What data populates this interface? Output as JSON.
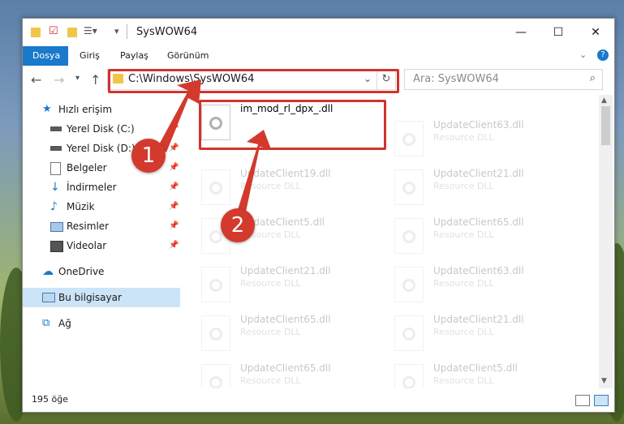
{
  "window": {
    "title": "SysWOW64",
    "controls": {
      "minimize": "—",
      "maximize": "☐",
      "close": "✕"
    }
  },
  "ribbon": {
    "tabs": [
      "Dosya",
      "Giriş",
      "Paylaş",
      "Görünüm"
    ]
  },
  "navigation": {
    "address": "C:\\Windows\\SysWOW64",
    "search_placeholder": "Ara: SysWOW64"
  },
  "sidebar": {
    "items": [
      {
        "label": "Hızlı erişim",
        "icon": "star-icon",
        "pinned": false
      },
      {
        "label": "Yerel Disk (C:)",
        "icon": "drive-icon",
        "pinned": true
      },
      {
        "label": "Yerel Disk (D:)",
        "icon": "drive-icon",
        "pinned": true
      },
      {
        "label": "Belgeler",
        "icon": "documents-icon",
        "pinned": true
      },
      {
        "label": "İndirmeler",
        "icon": "download-icon",
        "pinned": true
      },
      {
        "label": "Müzik",
        "icon": "music-icon",
        "pinned": true
      },
      {
        "label": "Resimler",
        "icon": "pictures-icon",
        "pinned": true
      },
      {
        "label": "Videolar",
        "icon": "videos-icon",
        "pinned": true
      },
      {
        "label": "OneDrive",
        "icon": "cloud-icon",
        "pinned": false
      },
      {
        "label": "Bu bilgisayar",
        "icon": "computer-icon",
        "pinned": false
      },
      {
        "label": "Ağ",
        "icon": "network-icon",
        "pinned": false
      }
    ]
  },
  "files": {
    "col1": [
      {
        "name": "im_mod_rl_dpx_.dll",
        "type": ""
      },
      {
        "name": "UpdateClient19.dll",
        "type": "Resource DLL"
      },
      {
        "name": "UpdateClient5.dll",
        "type": "Resource DLL"
      },
      {
        "name": "UpdateClient21.dll",
        "type": "Resource DLL"
      },
      {
        "name": "UpdateClient65.dll",
        "type": "Resource DLL"
      },
      {
        "name": "UpdateClient65.dll",
        "type": "Resource DLL"
      }
    ],
    "col2": [
      {
        "name": "UpdateClient63.dll",
        "type": "Resource DLL"
      },
      {
        "name": "UpdateClient21.dll",
        "type": "Resource DLL"
      },
      {
        "name": "UpdateClient65.dll",
        "type": "Resource DLL"
      },
      {
        "name": "UpdateClient63.dll",
        "type": "Resource DLL"
      },
      {
        "name": "UpdateClient21.dll",
        "type": "Resource DLL"
      },
      {
        "name": "UpdateClient5.dll",
        "type": "Resource DLL"
      }
    ]
  },
  "status": {
    "count": "195 öğe"
  },
  "annotations": {
    "step1": "1",
    "step2": "2",
    "color": "#d33a2d"
  }
}
